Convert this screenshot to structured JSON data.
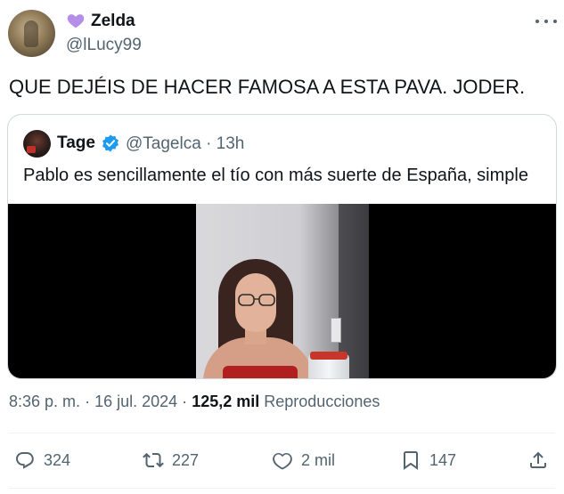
{
  "tweet": {
    "author": {
      "display_name": "Zelda",
      "handle": "@lLucy99",
      "emoji": "purple-heart"
    },
    "text": "QUE DEJÉIS DE HACER FAMOSA A ESTA PAVA. JODER.",
    "quote": {
      "author": {
        "display_name": "Tage",
        "handle": "@Tagelca",
        "time": "· 13h",
        "verified": true
      },
      "text": "Pablo es sencillamente el tío con más suerte de España, simple",
      "media": "video"
    },
    "meta": {
      "time": "8:36 p. m.",
      "separator1": "·",
      "date": "16 jul. 2024",
      "separator2": "·",
      "views_count": "125,2 mil",
      "views_label": "Reproducciones"
    },
    "actions": {
      "replies": "324",
      "retweets": "227",
      "likes": "2 mil",
      "bookmarks": "147"
    }
  },
  "colors": {
    "text": "#0f1419",
    "secondary": "#536471",
    "verified_blue": "#1d9bf0",
    "heart_purple": "#b48ee8",
    "border": "#cfd9de"
  },
  "icons": [
    "more-icon",
    "verified-badge-icon",
    "reply-icon",
    "retweet-icon",
    "like-icon",
    "bookmark-icon",
    "share-icon"
  ]
}
